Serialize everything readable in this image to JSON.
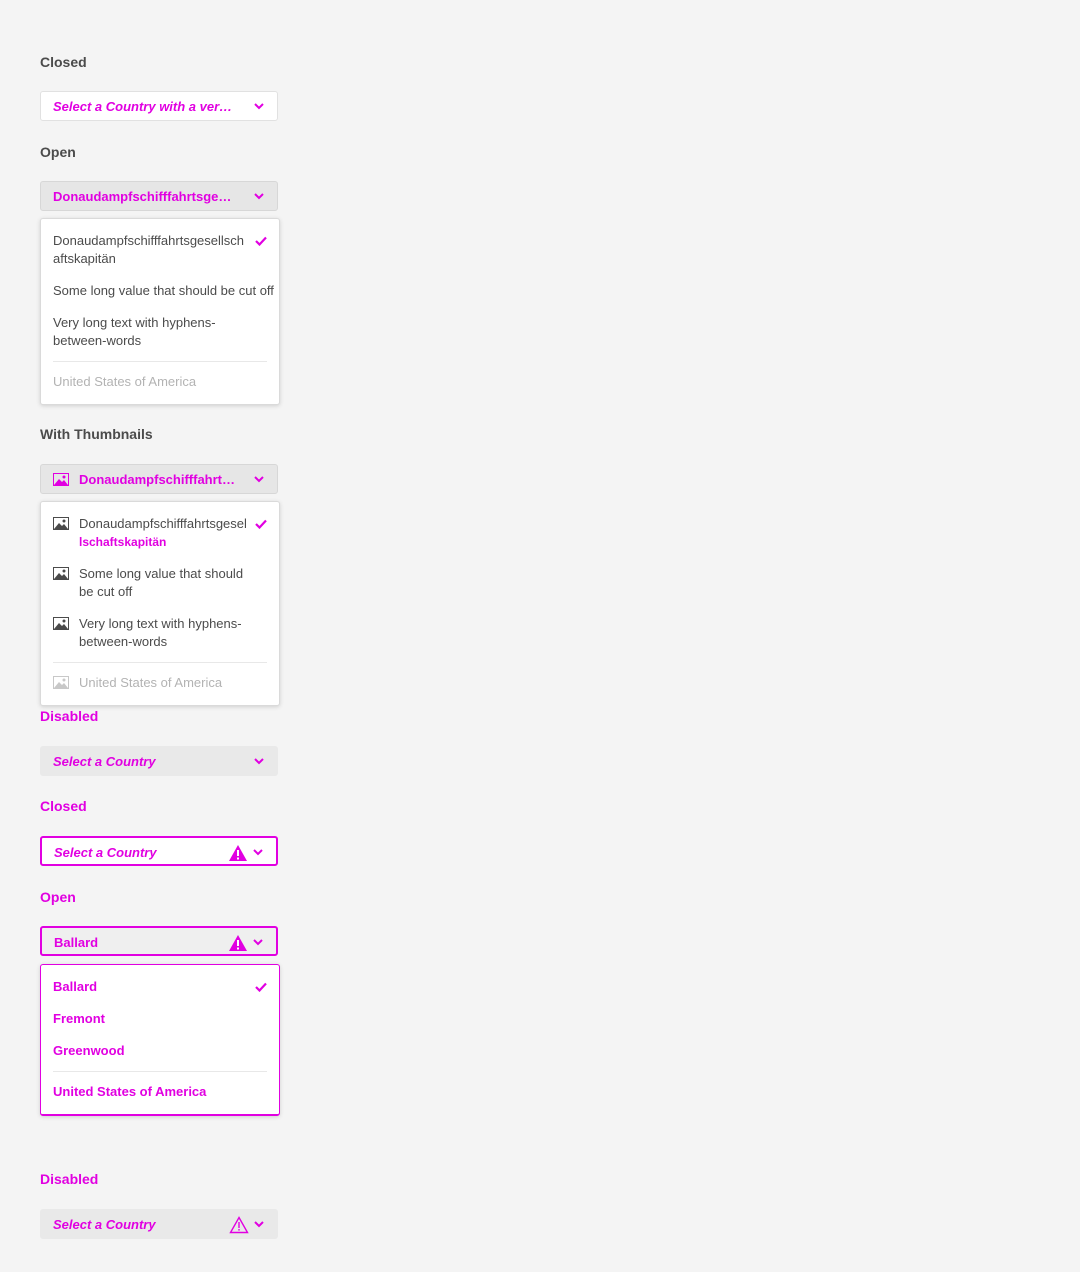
{
  "sections": {
    "closed_1": {
      "label": "Closed",
      "value": "Select a Country with a very long label"
    },
    "open_1": {
      "label": "Open",
      "value": "Donaudampfschifffahrtsgesellschaftskapitän",
      "items": [
        "Donaudampfschifffahrtsgesellsch aftskapitän",
        "Some long value that should be cut off",
        "Very long text with hyphens-between-words"
      ],
      "disabled_item": "United States of America"
    },
    "thumbs": {
      "label": "With Thumbnails",
      "value": "Donaudampfschifffahrtsgesellschaftskapitän",
      "items": [
        "Donaudampfschifffahrtsgesel",
        "Some long value that should be cut off",
        "Very long text with hyphens-between-words"
      ],
      "overflow_text": "lschaftskapitän",
      "disabled_item": "United States of America"
    },
    "disabled_1": {
      "label": "Disabled",
      "placeholder": "Select a Country"
    },
    "closed_invalid": {
      "label": "Closed",
      "placeholder": "Select a Country"
    },
    "open_invalid": {
      "label": "Open",
      "value": "Ballard",
      "items": [
        "Ballard",
        "Fremont",
        "Greenwood"
      ],
      "disabled_item": "United States of America"
    },
    "disabled_invalid": {
      "label": "Disabled",
      "placeholder": "Select a Country"
    }
  },
  "colors": {
    "accent": "#e100e1",
    "text": "#4b4b4b",
    "background": "#f4f4f4"
  },
  "icons": [
    "chevron-down-icon",
    "checkmark-icon",
    "alert-icon",
    "image-icon"
  ]
}
